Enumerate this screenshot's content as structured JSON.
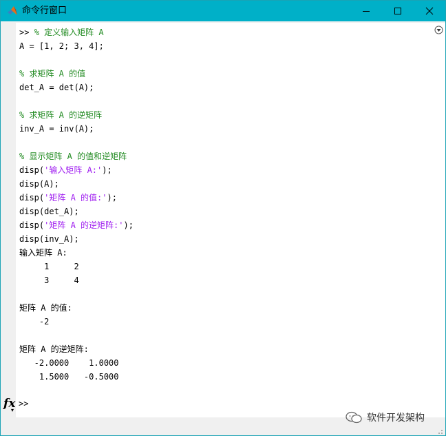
{
  "window": {
    "title": "命令行窗口",
    "accent_color": "#00b0c8",
    "controls": [
      "minimize-icon",
      "maximize-icon",
      "close-icon"
    ]
  },
  "console": {
    "lines": [
      [
        {
          "t": ">> ",
          "k": "plain"
        },
        {
          "t": "% 定义输入矩阵 A",
          "k": "comment"
        }
      ],
      [
        {
          "t": "A = [1, 2; 3, 4];",
          "k": "plain"
        }
      ],
      [],
      [
        {
          "t": "% 求矩阵 A 的值",
          "k": "comment"
        }
      ],
      [
        {
          "t": "det_A = det(A);",
          "k": "plain"
        }
      ],
      [],
      [
        {
          "t": "% 求矩阵 A 的逆矩阵",
          "k": "comment"
        }
      ],
      [
        {
          "t": "inv_A = inv(A);",
          "k": "plain"
        }
      ],
      [],
      [
        {
          "t": "% 显示矩阵 A 的值和逆矩阵",
          "k": "comment"
        }
      ],
      [
        {
          "t": "disp(",
          "k": "plain"
        },
        {
          "t": "'输入矩阵 A:'",
          "k": "string"
        },
        {
          "t": ");",
          "k": "plain"
        }
      ],
      [
        {
          "t": "disp(A);",
          "k": "plain"
        }
      ],
      [
        {
          "t": "disp(",
          "k": "plain"
        },
        {
          "t": "'矩阵 A 的值:'",
          "k": "string"
        },
        {
          "t": ");",
          "k": "plain"
        }
      ],
      [
        {
          "t": "disp(det_A);",
          "k": "plain"
        }
      ],
      [
        {
          "t": "disp(",
          "k": "plain"
        },
        {
          "t": "'矩阵 A 的逆矩阵:'",
          "k": "string"
        },
        {
          "t": ");",
          "k": "plain"
        }
      ],
      [
        {
          "t": "disp(inv_A);",
          "k": "plain"
        }
      ],
      [
        {
          "t": "输入矩阵 A:",
          "k": "plain"
        }
      ],
      [
        {
          "t": "     1     2",
          "k": "plain"
        }
      ],
      [
        {
          "t": "     3     4",
          "k": "plain"
        }
      ],
      [],
      [
        {
          "t": "矩阵 A 的值:",
          "k": "plain"
        }
      ],
      [
        {
          "t": "    -2",
          "k": "plain"
        }
      ],
      [],
      [
        {
          "t": "矩阵 A 的逆矩阵:",
          "k": "plain"
        }
      ],
      [
        {
          "t": "   -2.0000    1.0000",
          "k": "plain"
        }
      ],
      [
        {
          "t": "    1.5000   -0.5000",
          "k": "plain"
        }
      ]
    ],
    "colors": {
      "comment": "#228b22",
      "string": "#a020f0",
      "plain": "#000000"
    }
  },
  "command_line": {
    "fx_label": "fx",
    "prompt": ">>"
  },
  "watermark": {
    "text": "软件开发架构",
    "icon": "wechat-icon"
  }
}
